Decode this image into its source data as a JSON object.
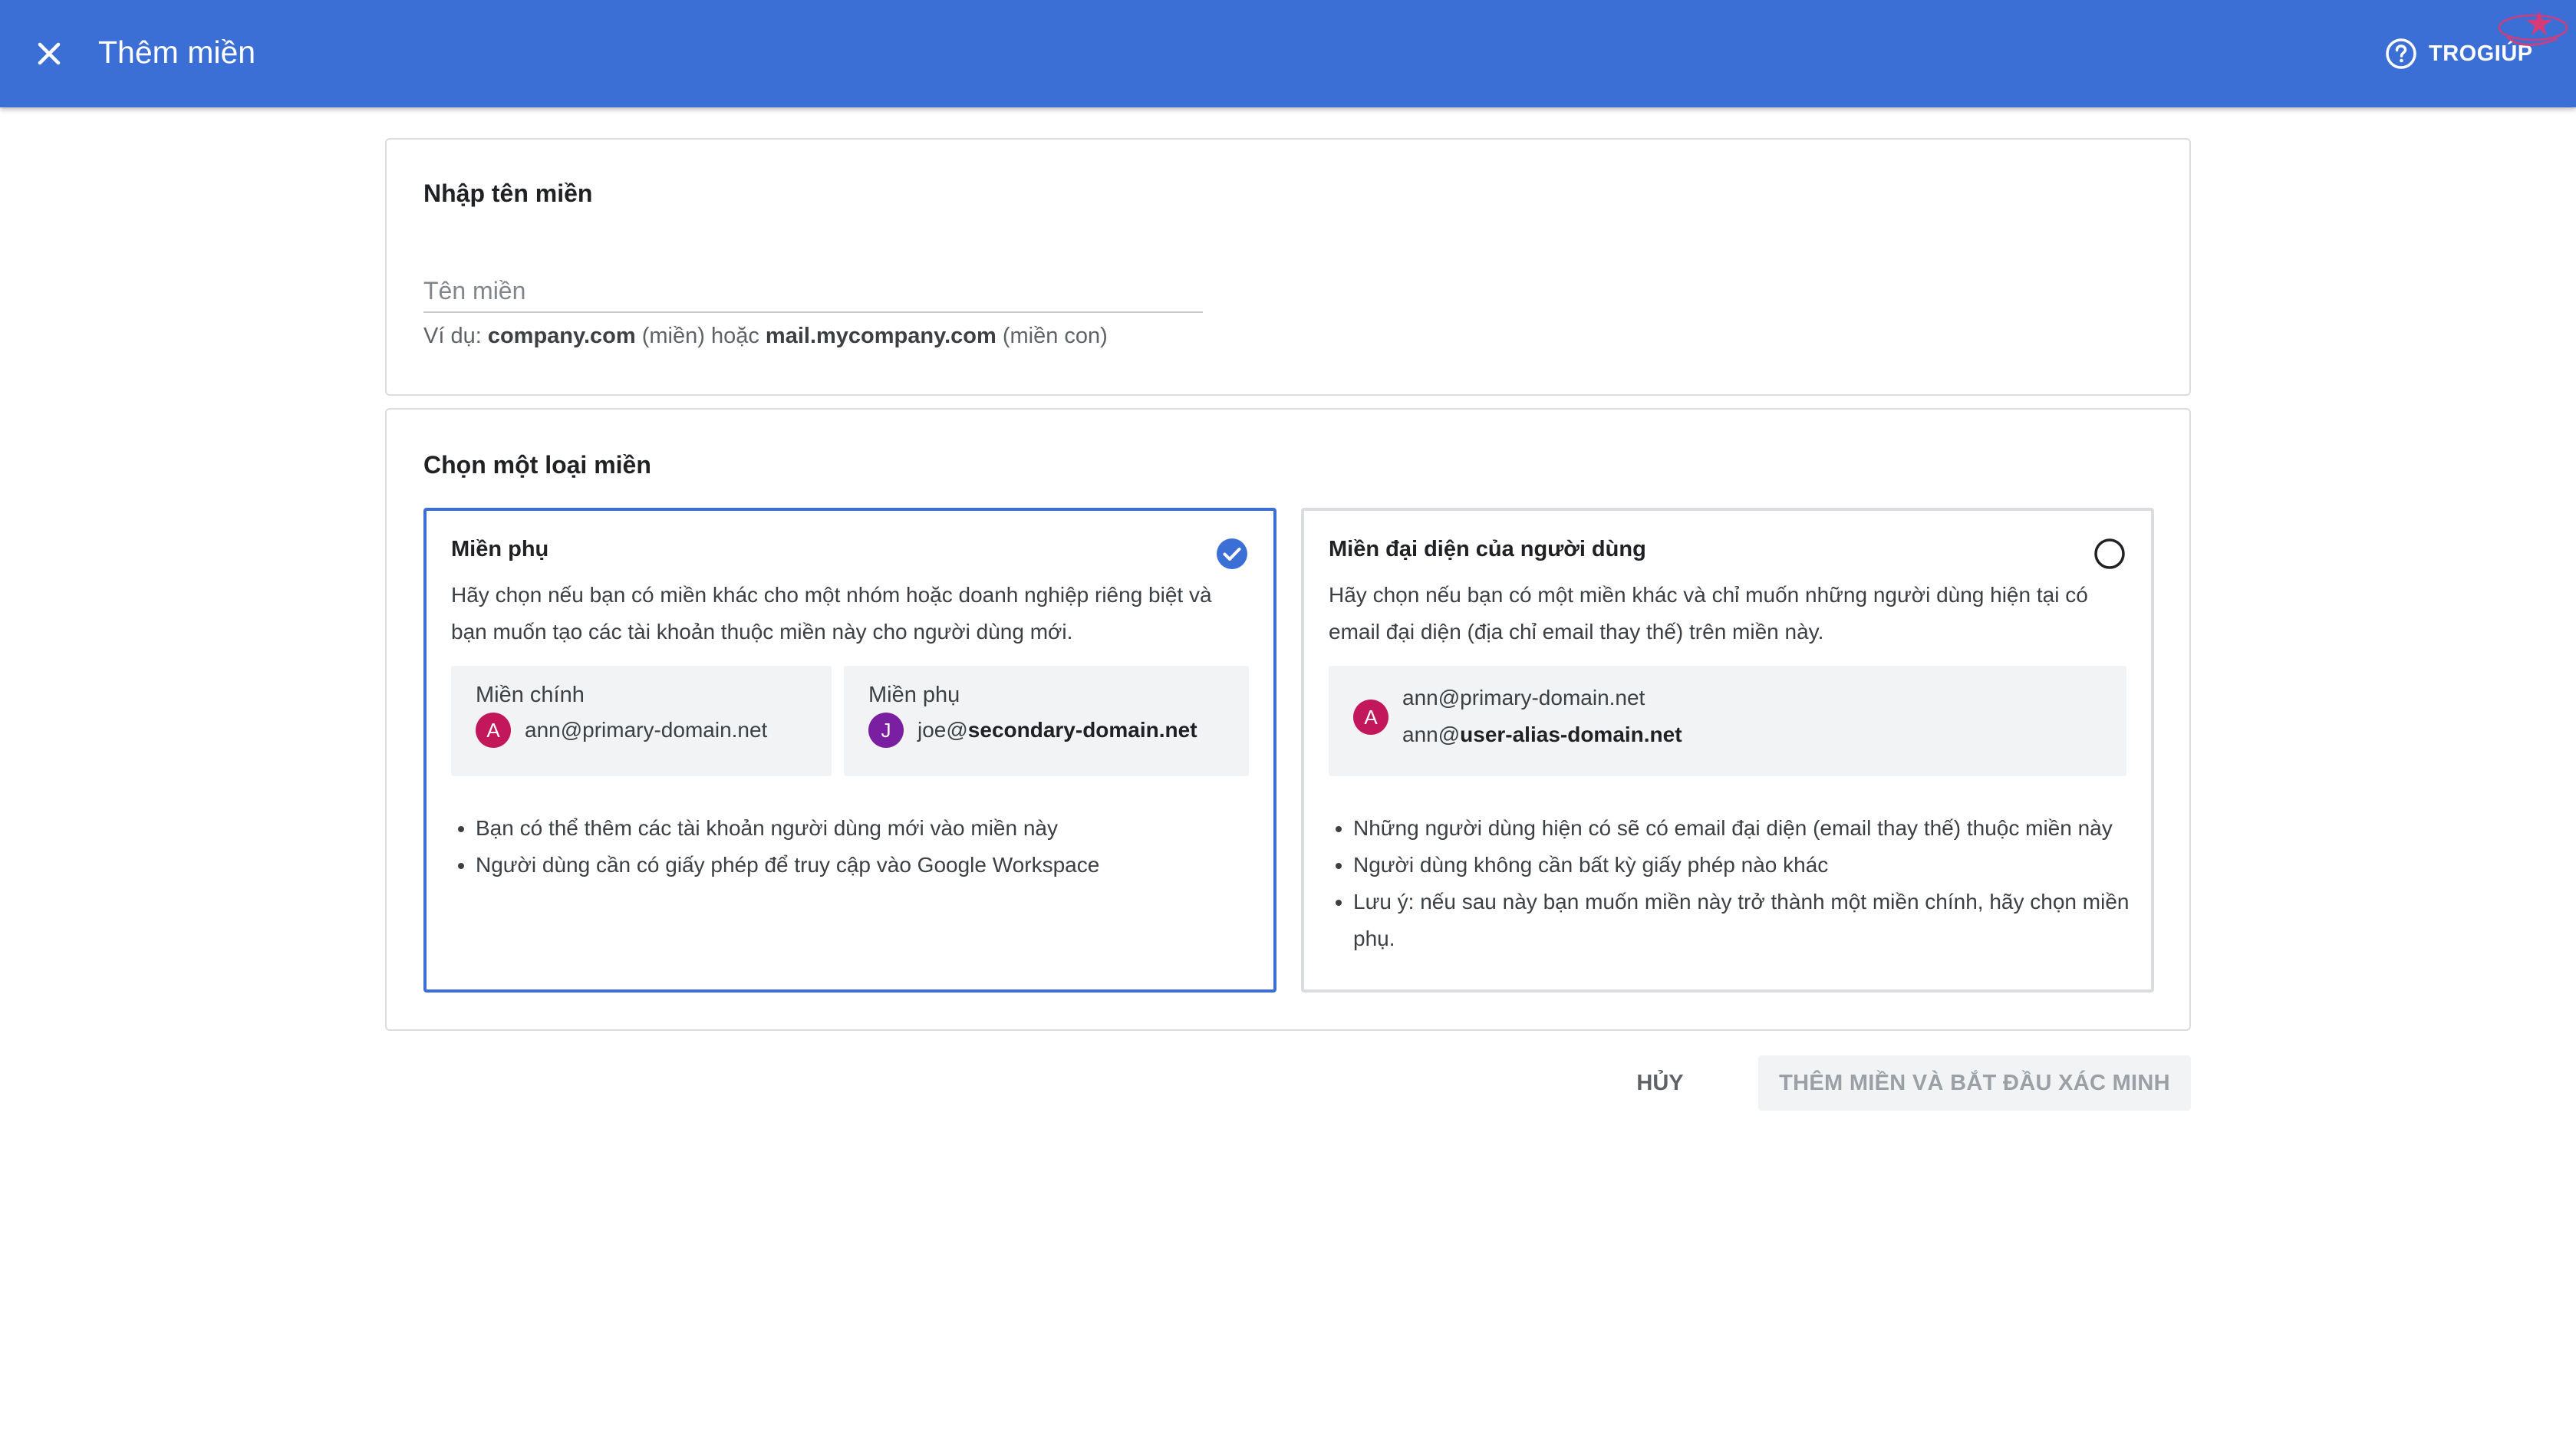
{
  "header": {
    "title": "Thêm miền",
    "help_label": "TROGIÚP"
  },
  "domain_card": {
    "title": "Nhập tên miền",
    "input_placeholder": "Tên miền",
    "input_value": "",
    "hint": {
      "prefix": "Ví dụ: ",
      "example1": "company.com",
      "middle": " (miền) hoặc ",
      "example2": "mail.mycompany.com",
      "suffix": " (miền con)"
    }
  },
  "type_card": {
    "title": "Chọn một loại miền",
    "options": [
      {
        "title": "Miền phụ",
        "selected": true,
        "description": "Hãy chọn nếu bạn có miền khác cho một nhóm hoặc doanh nghiệp riêng biệt và bạn muốn tạo các tài khoản thuộc miền này cho người dùng mới.",
        "examples": [
          {
            "heading": "Miền chính",
            "avatar": "A",
            "email": "ann@primary-domain.net"
          },
          {
            "heading": "Miền phụ",
            "avatar": "J",
            "email_user": "joe@",
            "email_domain": "secondary-domain.net"
          }
        ],
        "bullets": [
          "Bạn có thể thêm các tài khoản người dùng mới vào miền này",
          "Người dùng cần có giấy phép để truy cập vào Google Workspace"
        ]
      },
      {
        "title": "Miền đại diện của người dùng",
        "selected": false,
        "description": "Hãy chọn nếu bạn có một miền khác và chỉ muốn những người dùng hiện tại có email đại diện (địa chỉ email thay thế) trên miền này.",
        "example": {
          "avatar": "A",
          "line1": "ann@primary-domain.net",
          "line2_user": "ann@",
          "line2_domain": "user-alias-domain.net"
        },
        "bullets": [
          "Những người dùng hiện có sẽ có email đại diện (email thay thế) thuộc miền này",
          "Người dùng không cần bất kỳ giấy phép nào khác",
          "Lưu ý: nếu sau này bạn muốn miền này trở thành một miền chính, hãy chọn miền phụ."
        ]
      }
    ]
  },
  "actions": {
    "cancel_label": "HỦY",
    "submit_label": "THÊM MIỀN VÀ BẮT ĐẦU XÁC MINH"
  },
  "icons": {
    "close": "close-icon",
    "help": "help-circle-icon",
    "check": "check-circle-icon",
    "radio": "radio-unchecked-icon"
  },
  "colors": {
    "header": "#3b6fd6",
    "accent": "#3b6fd6",
    "avatar_a": "#c2185b",
    "avatar_j": "#7b1fa2"
  }
}
